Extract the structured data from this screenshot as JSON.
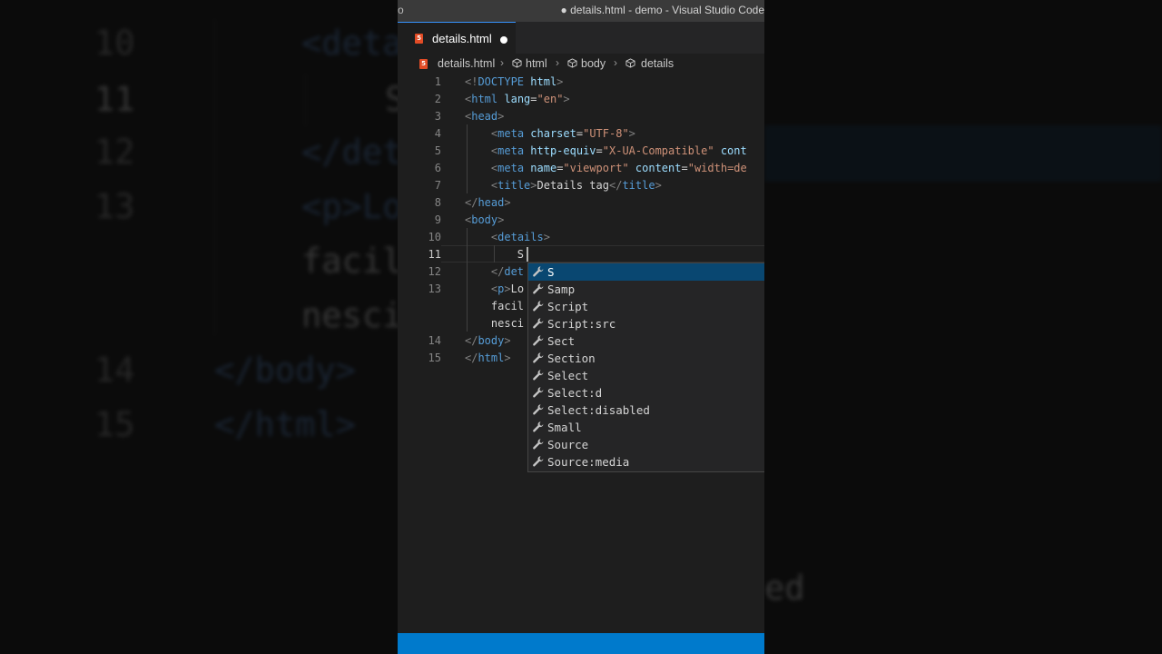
{
  "window": {
    "title": "● details.html - demo - Visual Studio Code",
    "title_left_fragment": "o"
  },
  "tab": {
    "label": "details.html",
    "modified": true
  },
  "breadcrumbs": [
    "details.html",
    "html",
    "body",
    "details"
  ],
  "lines": [
    {
      "n": "1",
      "tokens": [
        [
          "p",
          "<!"
        ],
        [
          "tag",
          "DOCTYPE"
        ],
        [
          "txt",
          " "
        ],
        [
          "attr",
          "html"
        ],
        [
          "p",
          ">"
        ]
      ]
    },
    {
      "n": "2",
      "tokens": [
        [
          "p",
          "<"
        ],
        [
          "tag",
          "html"
        ],
        [
          "txt",
          " "
        ],
        [
          "attr",
          "lang"
        ],
        [
          "txt",
          "="
        ],
        [
          "str",
          "\"en\""
        ],
        [
          "p",
          ">"
        ]
      ]
    },
    {
      "n": "3",
      "tokens": [
        [
          "p",
          "<"
        ],
        [
          "tag",
          "head"
        ],
        [
          "p",
          ">"
        ]
      ]
    },
    {
      "n": "4",
      "tokens": [
        [
          "txt",
          "    "
        ],
        [
          "p",
          "<"
        ],
        [
          "tag",
          "meta"
        ],
        [
          "txt",
          " "
        ],
        [
          "attr",
          "charset"
        ],
        [
          "txt",
          "="
        ],
        [
          "str",
          "\"UTF-8\""
        ],
        [
          "p",
          ">"
        ]
      ]
    },
    {
      "n": "5",
      "tokens": [
        [
          "txt",
          "    "
        ],
        [
          "p",
          "<"
        ],
        [
          "tag",
          "meta"
        ],
        [
          "txt",
          " "
        ],
        [
          "attr",
          "http-equiv"
        ],
        [
          "txt",
          "="
        ],
        [
          "str",
          "\"X-UA-Compatible\""
        ],
        [
          "txt",
          " "
        ],
        [
          "attr",
          "cont"
        ]
      ]
    },
    {
      "n": "6",
      "tokens": [
        [
          "txt",
          "    "
        ],
        [
          "p",
          "<"
        ],
        [
          "tag",
          "meta"
        ],
        [
          "txt",
          " "
        ],
        [
          "attr",
          "name"
        ],
        [
          "txt",
          "="
        ],
        [
          "str",
          "\"viewport\""
        ],
        [
          "txt",
          " "
        ],
        [
          "attr",
          "content"
        ],
        [
          "txt",
          "="
        ],
        [
          "str",
          "\"width=de"
        ]
      ]
    },
    {
      "n": "7",
      "tokens": [
        [
          "txt",
          "    "
        ],
        [
          "p",
          "<"
        ],
        [
          "tag",
          "title"
        ],
        [
          "p",
          ">"
        ],
        [
          "txt",
          "Details tag"
        ],
        [
          "p",
          "</"
        ],
        [
          "tag",
          "title"
        ],
        [
          "p",
          ">"
        ]
      ]
    },
    {
      "n": "8",
      "tokens": [
        [
          "p",
          "</"
        ],
        [
          "tag",
          "head"
        ],
        [
          "p",
          ">"
        ]
      ]
    },
    {
      "n": "9",
      "tokens": [
        [
          "p",
          "<"
        ],
        [
          "tag",
          "body"
        ],
        [
          "p",
          ">"
        ]
      ]
    },
    {
      "n": "10",
      "tokens": [
        [
          "txt",
          "    "
        ],
        [
          "p",
          "<"
        ],
        [
          "tag",
          "details"
        ],
        [
          "p",
          ">"
        ]
      ]
    },
    {
      "n": "11",
      "tokens": [
        [
          "txt",
          "        S"
        ]
      ],
      "active": true
    },
    {
      "n": "12",
      "tokens": [
        [
          "txt",
          "    "
        ],
        [
          "p",
          "</"
        ],
        [
          "tag",
          "det"
        ]
      ]
    },
    {
      "n": "13",
      "tokens": [
        [
          "txt",
          "    "
        ],
        [
          "p",
          "<"
        ],
        [
          "tag",
          "p"
        ],
        [
          "p",
          ">"
        ],
        [
          "txt",
          "Lo"
        ]
      ]
    },
    {
      "n": "",
      "tokens": [
        [
          "txt",
          "    facil"
        ]
      ]
    },
    {
      "n": "",
      "tokens": [
        [
          "txt",
          "    nesci"
        ]
      ]
    },
    {
      "n": "14",
      "tokens": [
        [
          "p",
          "</"
        ],
        [
          "tag",
          "body"
        ],
        [
          "p",
          ">"
        ]
      ]
    },
    {
      "n": "15",
      "tokens": [
        [
          "p",
          "</"
        ],
        [
          "tag",
          "html"
        ],
        [
          "p",
          ">"
        ]
      ]
    }
  ],
  "suggestions": [
    "S",
    "Samp",
    "Script",
    "Script:src",
    "Sect",
    "Section",
    "Select",
    "Select:d",
    "Select:disabled",
    "Small",
    "Source",
    "Source:media"
  ],
  "selected_suggestion": 0,
  "background_zoom": [
    {
      "num": "10",
      "code": "<deta"
    },
    {
      "num": "11",
      "code": "S"
    },
    {
      "num": "12",
      "code": "</det"
    },
    {
      "num": "13",
      "code": "<p>Lo"
    },
    {
      "num": "",
      "code": "facil"
    },
    {
      "num": "",
      "code": "nesci"
    },
    {
      "num": "14",
      "code": "</body>"
    },
    {
      "num": "15",
      "code": "</html>"
    }
  ],
  "background_right_text": "ed",
  "colors": {
    "accent": "#007acc",
    "selection": "#094771",
    "editor_bg": "#1e1e1e"
  }
}
